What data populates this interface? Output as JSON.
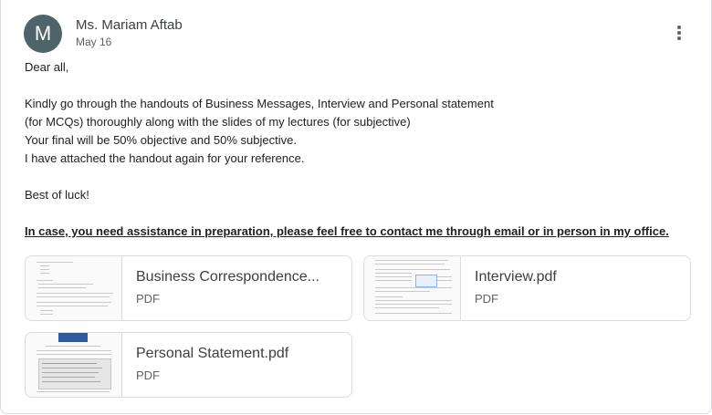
{
  "sender": {
    "initial": "M",
    "name": "Ms. Mariam Aftab",
    "date": "May 16"
  },
  "message": {
    "greeting": "Dear all,",
    "line1": "Kindly go through the handouts of Business Messages, Interview and Personal statement",
    "line2": "(for MCQs)  thoroughly along with the slides of my lectures (for subjective)",
    "line3": "Your final will be 50% objective and 50% subjective.",
    "line4": "I have attached the handout again for your reference.",
    "closing": "Best of luck!",
    "note": "In case, you need assistance in preparation, please feel free to contact me through email or in person in my office."
  },
  "attachments": [
    {
      "name": "Business Correspondence...",
      "type": "PDF"
    },
    {
      "name": "Interview.pdf",
      "type": "PDF"
    },
    {
      "name": "Personal Statement.pdf",
      "type": "PDF"
    }
  ],
  "icons": {
    "more": "more-vert-icon"
  },
  "colors": {
    "avatar": "#4f6469",
    "border": "#dadce0"
  }
}
